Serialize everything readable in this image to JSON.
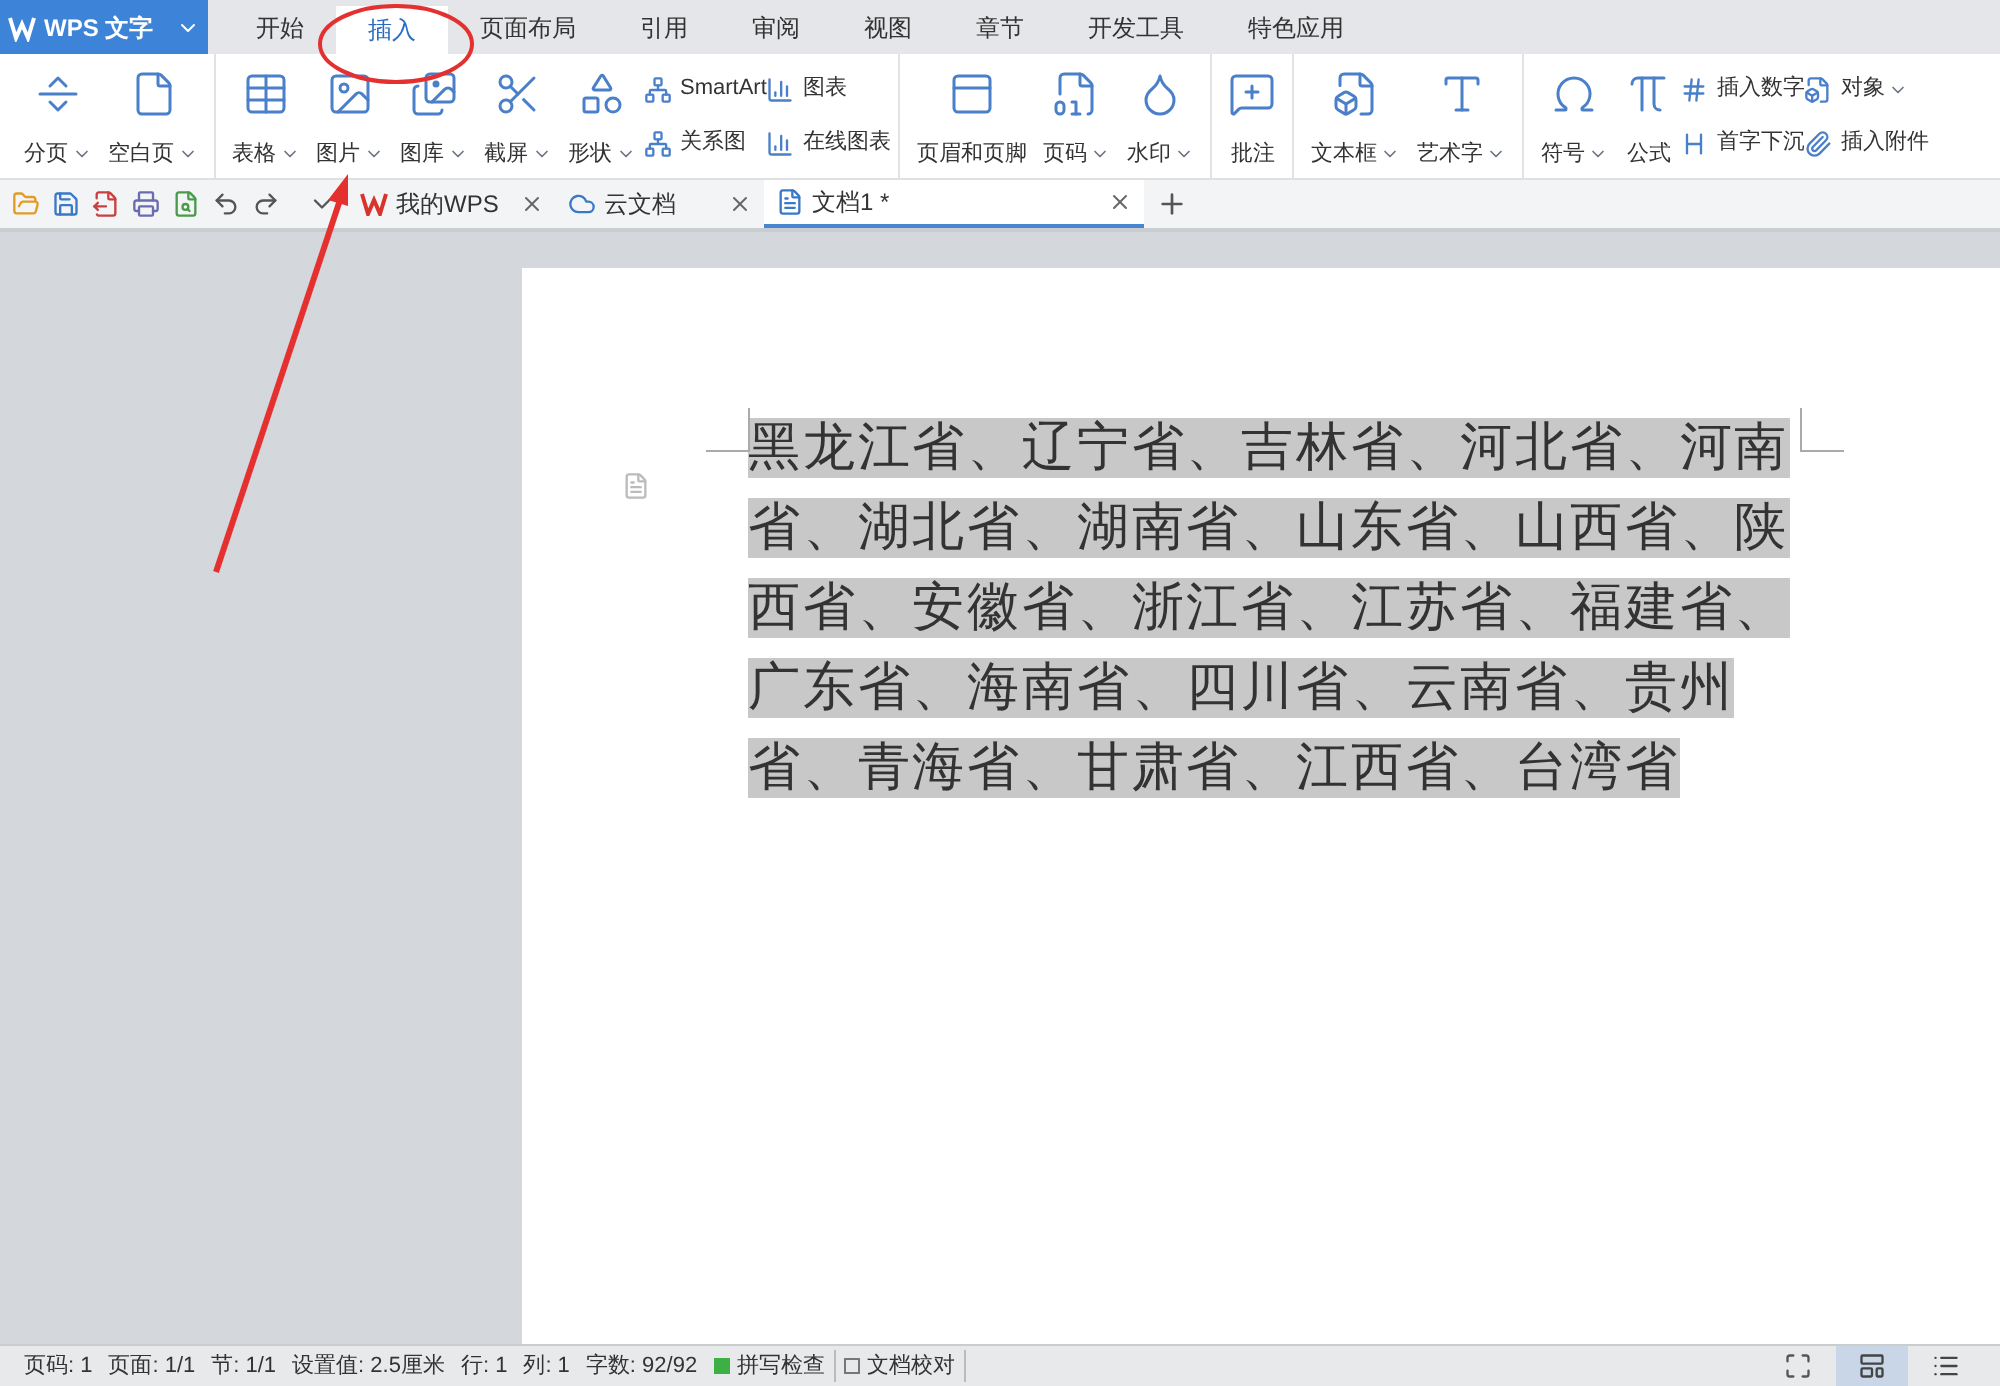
{
  "app_button": {
    "label": "WPS 文字"
  },
  "menu_tabs": [
    {
      "label": "开始",
      "selected": false
    },
    {
      "label": "插入",
      "selected": true
    },
    {
      "label": "页面布局",
      "selected": false
    },
    {
      "label": "引用",
      "selected": false
    },
    {
      "label": "审阅",
      "selected": false
    },
    {
      "label": "视图",
      "selected": false
    },
    {
      "label": "章节",
      "selected": false
    },
    {
      "label": "开发工具",
      "selected": false
    },
    {
      "label": "特色应用",
      "selected": false
    }
  ],
  "ribbon": {
    "groups": [
      {
        "items": [
          {
            "kind": "large",
            "label": "分页",
            "dropdown": true
          },
          {
            "kind": "large",
            "label": "空白页",
            "dropdown": true
          }
        ]
      },
      {
        "items": [
          {
            "kind": "large",
            "label": "表格",
            "dropdown": true
          },
          {
            "kind": "large",
            "label": "图片",
            "dropdown": true
          },
          {
            "kind": "large",
            "label": "图库",
            "dropdown": true
          },
          {
            "kind": "large",
            "label": "截屏",
            "dropdown": true
          },
          {
            "kind": "large",
            "label": "形状",
            "dropdown": true
          },
          {
            "kind": "small",
            "top": "SmartArt",
            "bottom": "关系图",
            "top_dropdown": false
          },
          {
            "kind": "small",
            "top": "图表",
            "bottom": "在线图表",
            "top_dropdown": false
          }
        ]
      },
      {
        "items": [
          {
            "kind": "large",
            "label": "页眉和页脚",
            "dropdown": false
          },
          {
            "kind": "large",
            "label": "页码",
            "dropdown": true
          },
          {
            "kind": "large",
            "label": "水印",
            "dropdown": true
          }
        ]
      },
      {
        "items": [
          {
            "kind": "large",
            "label": "批注",
            "dropdown": false
          }
        ]
      },
      {
        "items": [
          {
            "kind": "large",
            "label": "文本框",
            "dropdown": true
          },
          {
            "kind": "large",
            "label": "艺术字",
            "dropdown": true
          }
        ]
      },
      {
        "items": [
          {
            "kind": "large",
            "label": "符号",
            "dropdown": true
          },
          {
            "kind": "large",
            "label": "公式",
            "dropdown": false
          },
          {
            "kind": "small",
            "top": "插入数字",
            "bottom": "首字下沉",
            "top_dropdown": false
          },
          {
            "kind": "small",
            "top": "对象",
            "bottom": "插入附件",
            "top_dropdown": true
          }
        ]
      }
    ]
  },
  "doc_tabs": [
    {
      "label": "我的WPS",
      "selected": false
    },
    {
      "label": "云文档",
      "selected": false
    },
    {
      "label": "文档1 *",
      "selected": true
    }
  ],
  "document": {
    "text": "黑龙江省、辽宁省、吉林省、河北省、河南省、湖北省、湖南省、山东省、山西省、陕西省、安徽省、浙江省、江苏省、福建省、广东省、海南省、四川省、云南省、贵州省、青海省、甘肃省、江西省、台湾省",
    "selected": true
  },
  "status_bar": [
    {
      "kind": "text",
      "label": "页码: 1"
    },
    {
      "kind": "text",
      "label": "页面: 1/1"
    },
    {
      "kind": "text",
      "label": "节: 1/1"
    },
    {
      "kind": "text",
      "label": "设置值: 2.5厘米"
    },
    {
      "kind": "text",
      "label": "行: 1"
    },
    {
      "kind": "text",
      "label": "列: 1"
    },
    {
      "kind": "text",
      "label": "字数: 92/92"
    },
    {
      "kind": "check",
      "label": "拼写检查",
      "checked": true
    },
    {
      "kind": "check",
      "label": "文档校对",
      "checked": false
    }
  ]
}
